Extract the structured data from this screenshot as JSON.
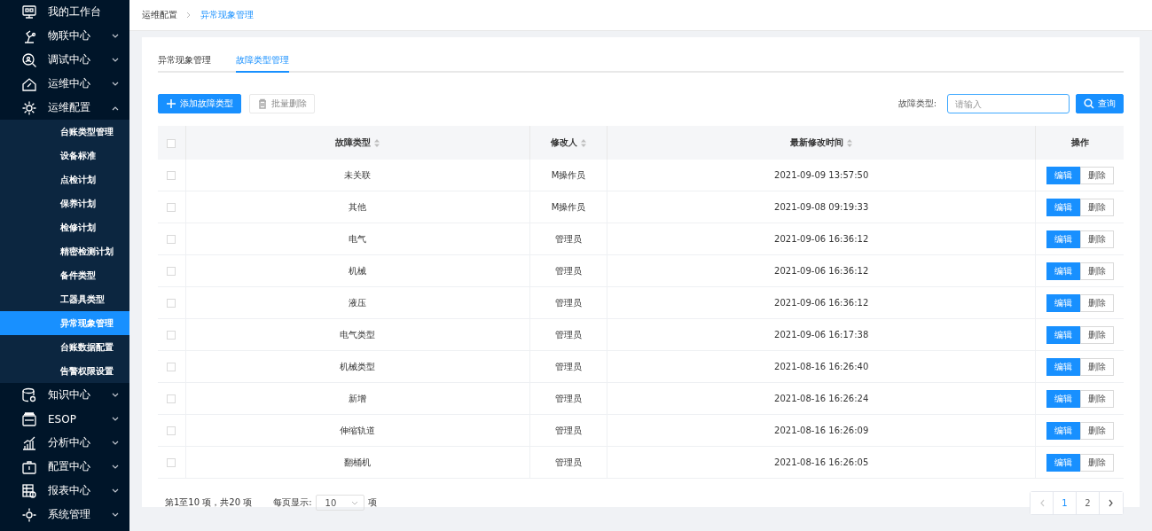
{
  "sidebar": {
    "items": [
      {
        "label": "我的工作台",
        "has_children": false
      },
      {
        "label": "物联中心",
        "expanded": false,
        "has_children": true
      },
      {
        "label": "调试中心",
        "expanded": false,
        "has_children": true
      },
      {
        "label": "运维中心",
        "expanded": false,
        "has_children": true
      },
      {
        "label": "运维配置",
        "expanded": true,
        "has_children": true,
        "children": [
          {
            "label": "台账类型管理",
            "selected": false
          },
          {
            "label": "设备标准",
            "selected": false
          },
          {
            "label": "点检计划",
            "selected": false
          },
          {
            "label": "保养计划",
            "selected": false
          },
          {
            "label": "检修计划",
            "selected": false
          },
          {
            "label": "精密检测计划",
            "selected": false
          },
          {
            "label": "备件类型",
            "selected": false
          },
          {
            "label": "工器具类型",
            "selected": false
          },
          {
            "label": "异常现象管理",
            "selected": true
          },
          {
            "label": "台账数据配置",
            "selected": false
          },
          {
            "label": "告警权限设置",
            "selected": false
          }
        ]
      },
      {
        "label": "知识中心",
        "expanded": false,
        "has_children": true
      },
      {
        "label": "ESOP",
        "expanded": false,
        "has_children": true
      },
      {
        "label": "分析中心",
        "expanded": false,
        "has_children": true
      },
      {
        "label": "配置中心",
        "expanded": false,
        "has_children": true
      },
      {
        "label": "报表中心",
        "expanded": false,
        "has_children": true
      },
      {
        "label": "系统管理",
        "expanded": false,
        "has_children": true
      }
    ]
  },
  "breadcrumb": [
    {
      "label": "运维配置",
      "current": false
    },
    {
      "label": "异常现象管理",
      "current": true
    }
  ],
  "tabs": [
    {
      "label": "异常现象管理",
      "selected": false
    },
    {
      "label": "故障类型管理",
      "selected": true
    }
  ],
  "toolbar": {
    "add_button": "添加故障类型",
    "batch_delete_button": "批量删除",
    "batch_delete_disabled": true,
    "filter_label": "故障类型:",
    "filter_placeholder": "请输入",
    "search_button": "查询"
  },
  "table": {
    "select_all_checked": false,
    "columns": [
      {
        "label": "故障类型",
        "sortable": true
      },
      {
        "label": "修改人",
        "sortable": true
      },
      {
        "label": "最新修改时间",
        "sortable": true
      },
      {
        "label": "操作",
        "sortable": false
      }
    ],
    "rows": [
      {
        "checked": false,
        "cells": [
          "未关联",
          "M操作员",
          "2021-09-09 13:57:50"
        ],
        "edit": "编辑",
        "delete": "删除"
      },
      {
        "checked": false,
        "cells": [
          "其他",
          "M操作员",
          "2021-09-08 09:19:33"
        ],
        "edit": "编辑",
        "delete": "删除"
      },
      {
        "checked": false,
        "cells": [
          "电气",
          "管理员",
          "2021-09-06 16:36:12"
        ],
        "edit": "编辑",
        "delete": "删除"
      },
      {
        "checked": false,
        "cells": [
          "机械",
          "管理员",
          "2021-09-06 16:36:12"
        ],
        "edit": "编辑",
        "delete": "删除"
      },
      {
        "checked": false,
        "cells": [
          "液压",
          "管理员",
          "2021-09-06 16:36:12"
        ],
        "edit": "编辑",
        "delete": "删除"
      },
      {
        "checked": false,
        "cells": [
          "电气类型",
          "管理员",
          "2021-09-06 16:17:38"
        ],
        "edit": "编辑",
        "delete": "删除"
      },
      {
        "checked": false,
        "cells": [
          "机械类型",
          "管理员",
          "2021-08-16 16:26:40"
        ],
        "edit": "编辑",
        "delete": "删除"
      },
      {
        "checked": false,
        "cells": [
          "新增",
          "管理员",
          "2021-08-16 16:26:24"
        ],
        "edit": "编辑",
        "delete": "删除"
      },
      {
        "checked": false,
        "cells": [
          "伸缩轨道",
          "管理员",
          "2021-08-16 16:26:09"
        ],
        "edit": "编辑",
        "delete": "删除"
      },
      {
        "checked": false,
        "cells": [
          "翻桶机",
          "管理员",
          "2021-08-16 16:26:05"
        ],
        "edit": "编辑",
        "delete": "删除"
      }
    ]
  },
  "pagination": {
    "summary": "第1至10 项，共20  项",
    "page_size_label": "每页显示:",
    "page_size": "10",
    "page_size_unit": "项",
    "prev_disabled": true,
    "next_disabled": false,
    "pages": [
      {
        "label": "1",
        "selected": true
      },
      {
        "label": "2",
        "selected": false
      }
    ]
  }
}
